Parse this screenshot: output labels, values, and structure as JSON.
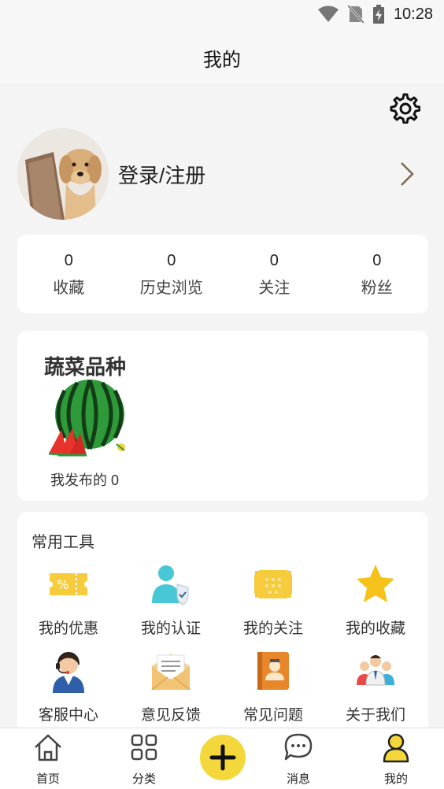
{
  "status_bar": {
    "time": "10:28"
  },
  "header": {
    "title": "我的"
  },
  "profile": {
    "login_label": "登录/注册"
  },
  "stats": [
    {
      "value": "0",
      "label": "收藏"
    },
    {
      "value": "0",
      "label": "历史浏览"
    },
    {
      "value": "0",
      "label": "关注"
    },
    {
      "value": "0",
      "label": "粉丝"
    }
  ],
  "vegetable": {
    "title": "蔬菜品种",
    "caption": "我发布的 0"
  },
  "tools": {
    "title": "常用工具",
    "items": [
      {
        "label": "我的优惠",
        "icon": "coupon-icon"
      },
      {
        "label": "我的认证",
        "icon": "certification-icon"
      },
      {
        "label": "我的关注",
        "icon": "follow-icon"
      },
      {
        "label": "我的收藏",
        "icon": "star-icon"
      },
      {
        "label": "客服中心",
        "icon": "customer-service-icon"
      },
      {
        "label": "意见反馈",
        "icon": "feedback-envelope-icon"
      },
      {
        "label": "常见问题",
        "icon": "faq-book-icon"
      },
      {
        "label": "关于我们",
        "icon": "team-icon"
      }
    ]
  },
  "tabbar": {
    "items": [
      {
        "label": "首页",
        "icon": "home-icon"
      },
      {
        "label": "分类",
        "icon": "grid-icon"
      },
      {
        "label": "消息",
        "icon": "message-icon"
      },
      {
        "label": "我的",
        "icon": "profile-icon"
      }
    ]
  },
  "colors": {
    "accent": "#f4d73b",
    "background": "#f4f4f4",
    "card": "#ffffff"
  }
}
